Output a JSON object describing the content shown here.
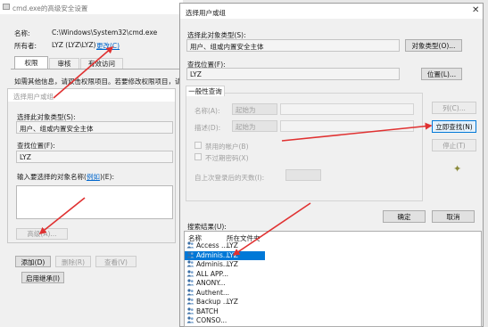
{
  "security": {
    "title": "cmd.exe的高级安全设置",
    "name_label": "名称:",
    "name_value": "C:\\Windows\\System32\\cmd.exe",
    "owner_label": "所有者:",
    "owner_value": "LYZ (LYZ\\LYZ)",
    "change_link": "更改(C)",
    "tabs": [
      "权限",
      "审核",
      "有效访问"
    ],
    "info": "如需其他信息，请双击权限项目。若要修改权限项目，请选",
    "add": "添加(D)",
    "remove": "删除(R)",
    "view": "查看(V)",
    "inherit": "启用继承(I)"
  },
  "small_dialog": {
    "title": "选择用户或组",
    "obj_type_label": "选择此对象类型(S):",
    "obj_type_value": "用户、组或内置安全主体",
    "location_label": "查找位置(F):",
    "location_value": "LYZ",
    "enter_label_prefix": "输入要选择的对象名称(",
    "enter_link": "例如",
    "enter_label_suffix": ")(E):",
    "advanced": "高级(A)..."
  },
  "main_dialog": {
    "title": "选择用户或组",
    "obj_type_label": "选择此对象类型(S):",
    "obj_type_value": "用户、组或内置安全主体",
    "obj_type_btn": "对象类型(O)...",
    "location_label": "查找位置(F):",
    "location_value": "LYZ",
    "location_btn": "位置(L)...",
    "group_title": "一般性查询",
    "name_label": "名称(A):",
    "desc_label": "描述(D):",
    "starts_with": "起始为",
    "disabled_accounts": "禁用的帐户(B)",
    "no_expire": "不过期密码(X)",
    "days_label": "自上次登录后的天数(I):",
    "columns_btn": "列(C)...",
    "find_now": "立即查找(N)",
    "stop": "停止(T)",
    "ok": "确定",
    "cancel": "取消",
    "results_label": "搜索结果(U):",
    "col_name": "名称",
    "col_folder": "所在文件夹",
    "results": [
      {
        "name": "Access ...",
        "folder": "LYZ"
      },
      {
        "name": "Adminis...",
        "folder": "LYZ"
      },
      {
        "name": "Adminis...",
        "folder": "LYZ"
      },
      {
        "name": "ALL APP...",
        "folder": ""
      },
      {
        "name": "ANONY...",
        "folder": ""
      },
      {
        "name": "Authent...",
        "folder": ""
      },
      {
        "name": "Backup ...",
        "folder": "LYZ"
      },
      {
        "name": "BATCH",
        "folder": ""
      },
      {
        "name": "CONSO...",
        "folder": ""
      }
    ]
  },
  "colors": {
    "arrow": "#e03131",
    "selection": "#0078d7",
    "link": "#0066cc"
  }
}
